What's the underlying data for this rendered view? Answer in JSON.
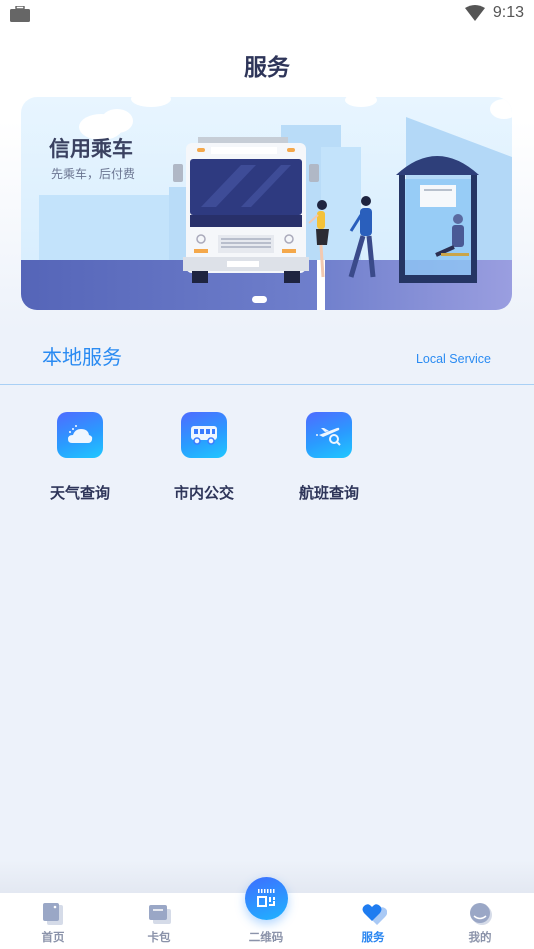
{
  "status_bar": {
    "time": "9:13",
    "left_icon": "briefcase-icon",
    "right_icons": [
      "wifi-icon"
    ]
  },
  "header": {
    "title": "服务"
  },
  "banner": {
    "title": "信用乘车",
    "subtitle": "先乘车，后付费",
    "page_indicator": {
      "current": 1
    }
  },
  "section": {
    "title": "本地服务",
    "subtitle": "Local Service"
  },
  "services": [
    {
      "label": "天气查询",
      "icon": "weather-cloud-icon"
    },
    {
      "label": "市内公交",
      "icon": "bus-icon"
    },
    {
      "label": "航班查询",
      "icon": "flight-search-icon"
    }
  ],
  "tabbar": {
    "tabs": [
      {
        "label": "首页",
        "icon": "home-icon",
        "active": false
      },
      {
        "label": "卡包",
        "icon": "wallet-icon",
        "active": false
      },
      {
        "label": "二维码",
        "icon": "qr-code-icon",
        "active": false
      },
      {
        "label": "服务",
        "icon": "heart-service-icon",
        "active": true
      },
      {
        "label": "我的",
        "icon": "profile-icon",
        "active": false
      }
    ]
  },
  "colors": {
    "accent": "#2a86f0",
    "title_text": "#2e3559",
    "background": "#edf2fa",
    "inactive_tab": "#8b93aa"
  }
}
